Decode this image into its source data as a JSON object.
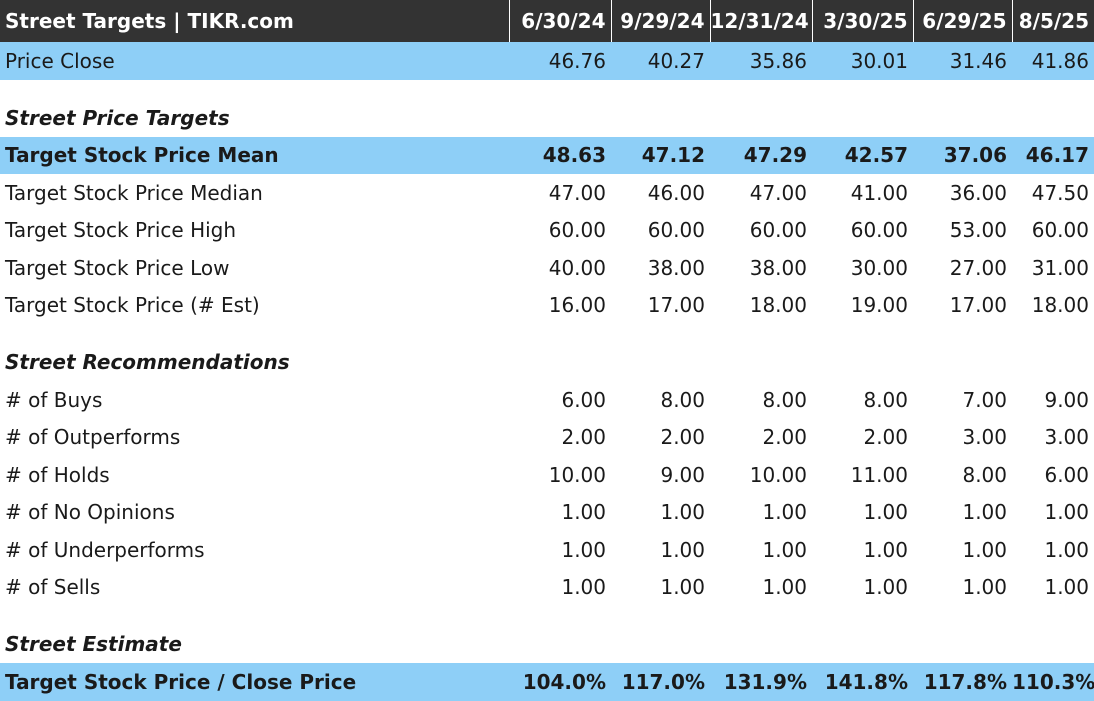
{
  "header": {
    "title": "Street Targets | TIKR.com",
    "dates": [
      "6/30/24",
      "9/29/24",
      "12/31/24",
      "3/30/25",
      "6/29/25",
      "8/5/25"
    ]
  },
  "price_close": {
    "label": "Price Close",
    "values": [
      "46.76",
      "40.27",
      "35.86",
      "30.01",
      "31.46",
      "41.86"
    ]
  },
  "sections": {
    "targets_title": "Street Price Targets",
    "recommendations_title": "Street Recommendations",
    "estimate_title": "Street Estimate"
  },
  "targets": [
    {
      "label": "Target Stock Price Mean",
      "values": [
        "48.63",
        "47.12",
        "47.29",
        "42.57",
        "37.06",
        "46.17"
      ]
    },
    {
      "label": "Target Stock Price Median",
      "values": [
        "47.00",
        "46.00",
        "47.00",
        "41.00",
        "36.00",
        "47.50"
      ]
    },
    {
      "label": "Target Stock Price High",
      "values": [
        "60.00",
        "60.00",
        "60.00",
        "60.00",
        "53.00",
        "60.00"
      ]
    },
    {
      "label": "Target Stock Price Low",
      "values": [
        "40.00",
        "38.00",
        "38.00",
        "30.00",
        "27.00",
        "31.00"
      ]
    },
    {
      "label": "Target Stock Price (# Est)",
      "values": [
        "16.00",
        "17.00",
        "18.00",
        "19.00",
        "17.00",
        "18.00"
      ]
    }
  ],
  "recommendations": [
    {
      "label": "# of Buys",
      "values": [
        "6.00",
        "8.00",
        "8.00",
        "8.00",
        "7.00",
        "9.00"
      ]
    },
    {
      "label": "# of Outperforms",
      "values": [
        "2.00",
        "2.00",
        "2.00",
        "2.00",
        "3.00",
        "3.00"
      ]
    },
    {
      "label": "# of Holds",
      "values": [
        "10.00",
        "9.00",
        "10.00",
        "11.00",
        "8.00",
        "6.00"
      ]
    },
    {
      "label": "# of No Opinions",
      "values": [
        "1.00",
        "1.00",
        "1.00",
        "1.00",
        "1.00",
        "1.00"
      ]
    },
    {
      "label": "# of Underperforms",
      "values": [
        "1.00",
        "1.00",
        "1.00",
        "1.00",
        "1.00",
        "1.00"
      ]
    },
    {
      "label": "# of Sells",
      "values": [
        "1.00",
        "1.00",
        "1.00",
        "1.00",
        "1.00",
        "1.00"
      ]
    }
  ],
  "estimate": {
    "label": "Target Stock Price / Close Price",
    "values": [
      "104.0%",
      "117.0%",
      "131.9%",
      "141.8%",
      "117.8%",
      "110.3%"
    ]
  },
  "colors": {
    "header_bg": "#333333",
    "highlight_bg": "#8ecff7"
  }
}
